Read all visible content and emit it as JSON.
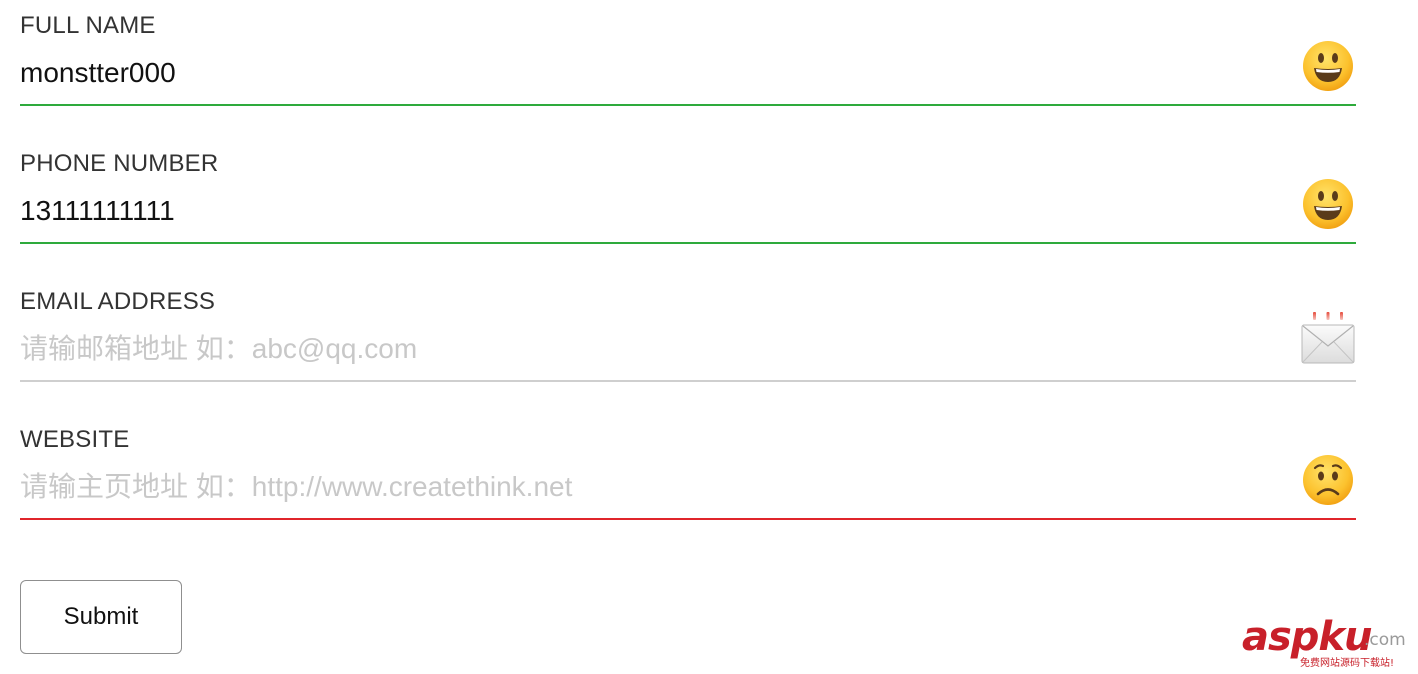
{
  "colors": {
    "valid": "#2eaa3c",
    "neutral": "#cfcfcf",
    "invalid": "#e0252b",
    "placeholder": "#c8c8c8",
    "watermark": "#c8202a"
  },
  "form": {
    "full_name": {
      "label": "FULL NAME",
      "value": "monstter000",
      "placeholder": "",
      "status": "valid",
      "icon": "smiley-face-icon"
    },
    "phone": {
      "label": "PHONE NUMBER",
      "value": "13111111111",
      "placeholder": "",
      "status": "valid",
      "icon": "smiley-face-icon"
    },
    "email": {
      "label": "EMAIL ADDRESS",
      "value": "",
      "placeholder": "请输邮箱地址 如：abc@qq.com",
      "status": "neutral",
      "icon": "incoming-envelope-icon"
    },
    "website": {
      "label": "WEBSITE",
      "value": "",
      "placeholder": "请输主页地址 如：http://www.createthink.net",
      "status": "invalid",
      "icon": "worried-face-icon"
    },
    "submit_label": "Submit"
  },
  "watermark": {
    "brand": "aspku",
    "domain": ".com",
    "tagline": "免费网站源码下载站!"
  }
}
